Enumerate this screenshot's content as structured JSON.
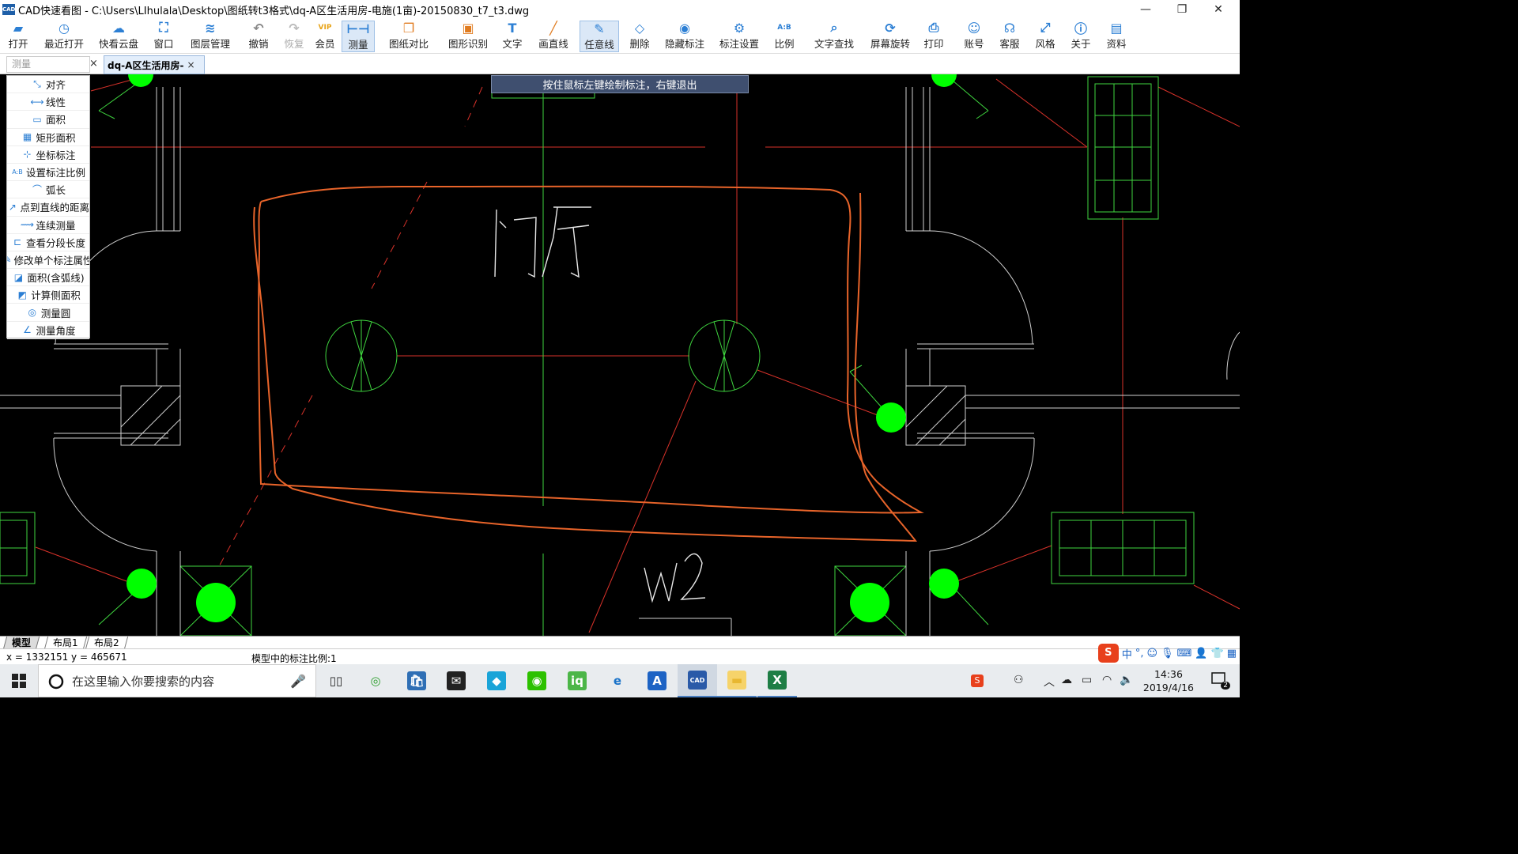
{
  "window": {
    "title": "CAD快速看图 - C:\\Users\\LIhulala\\Desktop\\图纸转t3格式\\dq-A区生活用房-电施(1亩)-20150830_t7_t3.dwg",
    "app_icon_text": "CAD"
  },
  "toolbar": [
    {
      "label": "打开",
      "icon": "open-folder-icon",
      "color": "#2c7fd4"
    },
    {
      "label": "最近打开",
      "icon": "recent-clock-icon",
      "color": "#2c7fd4"
    },
    {
      "label": "快看云盘",
      "icon": "cloud-icon",
      "color": "#2c7fd4"
    },
    {
      "label": "窗口",
      "icon": "window-icon",
      "color": "#2c7fd4"
    },
    {
      "label": "图层管理",
      "icon": "layers-icon",
      "color": "#2c7fd4"
    },
    {
      "label": "撤销",
      "icon": "undo-icon",
      "color": "#888"
    },
    {
      "label": "恢复",
      "icon": "redo-icon",
      "color": "#bbb"
    },
    {
      "label": "会员",
      "icon": "vip-icon",
      "color": "#e8a317"
    },
    {
      "label": "测量",
      "icon": "measure-ruler-icon",
      "color": "#2c7fd4"
    },
    {
      "label": "图纸对比",
      "icon": "compare-icon",
      "color": "#e07b1f"
    },
    {
      "label": "图形识别",
      "icon": "shape-recognize-icon",
      "color": "#e07b1f"
    },
    {
      "label": "文字",
      "icon": "text-icon",
      "color": "#2c7fd4"
    },
    {
      "label": "画直线",
      "icon": "draw-line-icon",
      "color": "#e07b1f"
    },
    {
      "label": "任意线",
      "icon": "freehand-pen-icon",
      "color": "#2c7fd4"
    },
    {
      "label": "删除",
      "icon": "eraser-icon",
      "color": "#2c7fd4"
    },
    {
      "label": "隐藏标注",
      "icon": "hide-eye-icon",
      "color": "#2c7fd4"
    },
    {
      "label": "标注设置",
      "icon": "annotation-settings-icon",
      "color": "#2c7fd4"
    },
    {
      "label": "比例",
      "icon": "scale-icon",
      "color": "#2c7fd4"
    },
    {
      "label": "文字查找",
      "icon": "text-search-icon",
      "color": "#2c7fd4"
    },
    {
      "label": "屏幕旋转",
      "icon": "rotate-screen-icon",
      "color": "#2c7fd4"
    },
    {
      "label": "打印",
      "icon": "printer-icon",
      "color": "#2c7fd4"
    },
    {
      "label": "账号",
      "icon": "user-icon",
      "color": "#2c7fd4"
    },
    {
      "label": "客服",
      "icon": "headset-icon",
      "color": "#2c7fd4"
    },
    {
      "label": "风格",
      "icon": "style-icon",
      "color": "#2c7fd4"
    },
    {
      "label": "关于",
      "icon": "info-icon",
      "color": "#2c7fd4"
    },
    {
      "label": "资料",
      "icon": "documents-icon",
      "color": "#2c7fd4"
    }
  ],
  "toolbar_active": [
    "测量",
    "任意线"
  ],
  "search": {
    "placeholder": "测量",
    "close": "×"
  },
  "doc_tab": {
    "label": "dq-A区生活用房-",
    "close": "×"
  },
  "measure_menu": [
    {
      "label": "对齐",
      "icon": "align-measure-icon"
    },
    {
      "label": "线性",
      "icon": "linear-measure-icon"
    },
    {
      "label": "面积",
      "icon": "area-icon"
    },
    {
      "label": "矩形面积",
      "icon": "rect-area-icon"
    },
    {
      "label": "坐标标注",
      "icon": "coordinate-icon"
    },
    {
      "label": "设置标注比例",
      "icon": "annotation-scale-icon"
    },
    {
      "label": "弧长",
      "icon": "arc-length-icon"
    },
    {
      "label": "点到直线的距离",
      "icon": "point-line-distance-icon"
    },
    {
      "label": "连续测量",
      "icon": "continuous-measure-icon"
    },
    {
      "label": "查看分段长度",
      "icon": "segment-length-icon"
    },
    {
      "label": "修改单个标注属性",
      "icon": "edit-annotation-icon"
    },
    {
      "label": "面积(含弧线)",
      "icon": "arc-area-icon"
    },
    {
      "label": "计算侧面积",
      "icon": "side-area-icon"
    },
    {
      "label": "测量圆",
      "icon": "measure-circle-icon"
    },
    {
      "label": "测量角度",
      "icon": "measure-angle-icon"
    }
  ],
  "canvas": {
    "tooltip": "按住鼠标左键绘制标注，右键退出",
    "room_label": "门厅",
    "room_code": "W2",
    "colors": {
      "background": "#000000",
      "wall": "#cfcfcf",
      "green": "#3fd63f",
      "red": "#d9322a",
      "orange": "#e8642a",
      "fixture": "#00ff00"
    }
  },
  "layout_tabs": [
    "模型",
    "布局1",
    "布局2"
  ],
  "status": {
    "coords": "x = 1332151  y = 465671",
    "scale": "模型中的标注比例:1",
    "ime": "中"
  },
  "taskbar": {
    "search_placeholder": "在这里输入你要搜索的内容",
    "apps": [
      "task-view",
      "browser-360",
      "store",
      "mail",
      "qq",
      "wechat",
      "iqiyi",
      "edge",
      "word-a",
      "cad-viewer",
      "file-explorer",
      "excel"
    ],
    "time": "14:36",
    "date": "2019/4/16",
    "notification_count": "2"
  }
}
